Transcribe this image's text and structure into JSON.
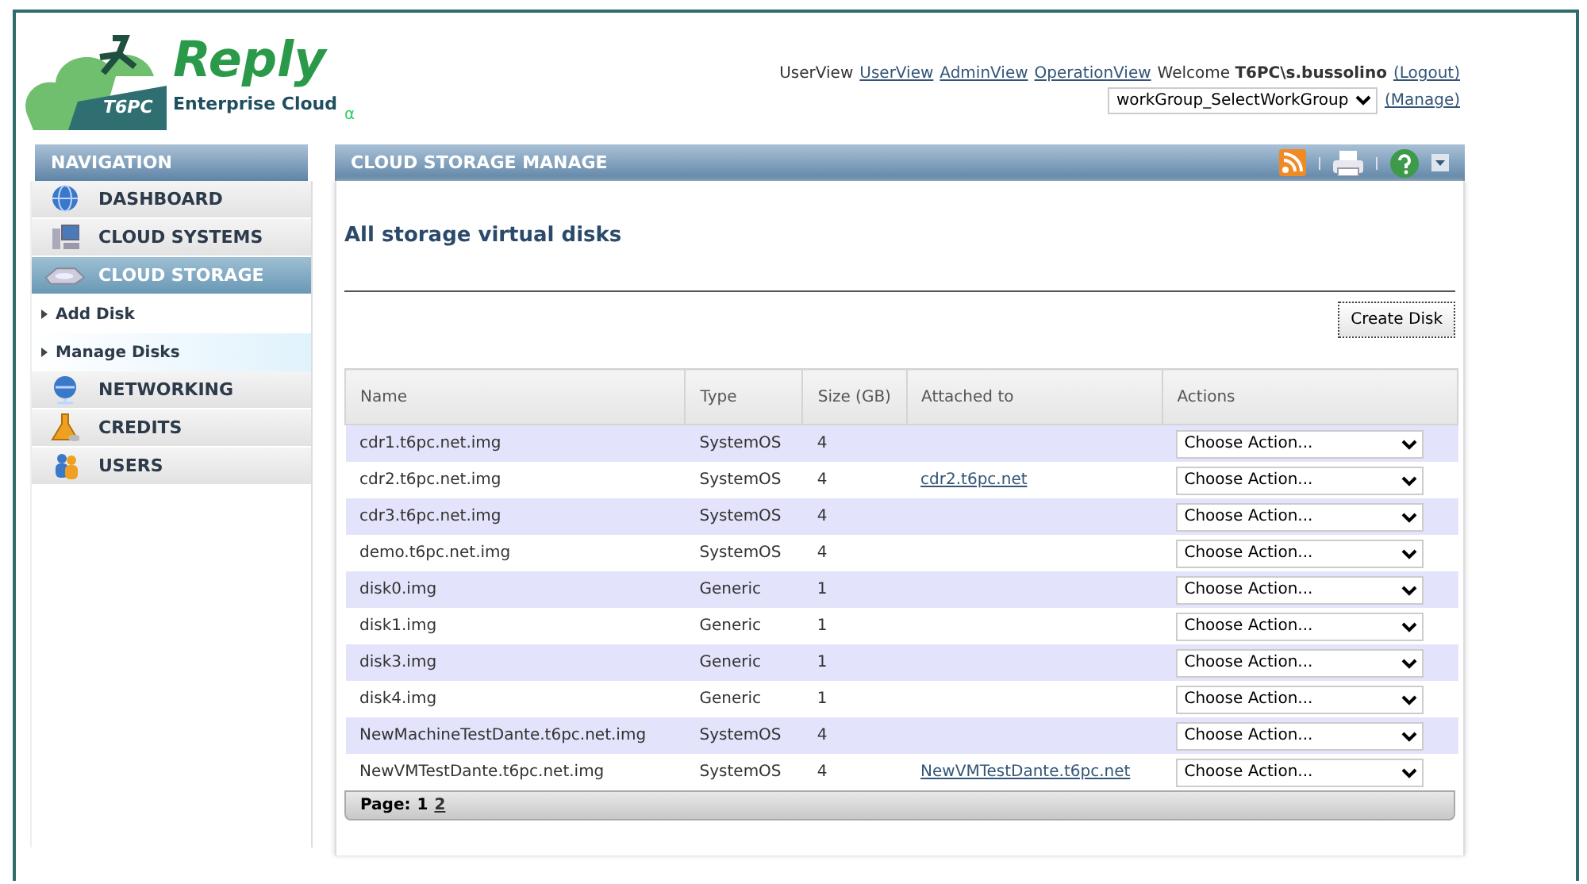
{
  "logo": {
    "brand": "Reply",
    "badge": "T6PC",
    "product": "Enterprise Cloud",
    "version": "α"
  },
  "user_bar": {
    "label": "UserView",
    "links": [
      "UserView",
      "AdminView",
      "OperationView"
    ],
    "welcome": "Welcome **T6PC\\s.bussolino**",
    "logout": "(Logout)",
    "workgroup": "workGroup_SelectWorkGroup",
    "manage": "(Manage)"
  },
  "navigation": {
    "title": "NAVIGATION",
    "items": [
      {
        "kind": "main",
        "label": "DASHBOARD",
        "selected": false
      },
      {
        "kind": "main",
        "label": "CLOUD SYSTEMS",
        "selected": false
      },
      {
        "kind": "main",
        "label": "CLOUD STORAGE",
        "selected": true
      },
      {
        "kind": "sub",
        "label": "Add Disk",
        "selected": false
      },
      {
        "kind": "sub",
        "label": "Manage Disks",
        "selected": true
      },
      {
        "kind": "main",
        "label": "NETWORKING",
        "selected": false
      },
      {
        "kind": "main",
        "label": "CREDITS",
        "selected": false
      },
      {
        "kind": "main",
        "label": "USERS",
        "selected": false
      }
    ]
  },
  "panel": {
    "title": "CLOUD STORAGE MANAGE",
    "heading": "All storage virtual disks",
    "create_button": "Create Disk",
    "table": {
      "columns": [
        "Name",
        "Type",
        "Size (GB)",
        "Attached to",
        "Actions"
      ],
      "rows": [
        {
          "name": "cdr1.t6pc.net.img",
          "type": "SystemOS",
          "size": "4",
          "attached": "",
          "action": "Choose Action..."
        },
        {
          "name": "cdr2.t6pc.net.img",
          "type": "SystemOS",
          "size": "4",
          "attached": "cdr2.t6pc.net",
          "action": "Choose Action..."
        },
        {
          "name": "cdr3.t6pc.net.img",
          "type": "SystemOS",
          "size": "4",
          "attached": "",
          "action": "Choose Action..."
        },
        {
          "name": "demo.t6pc.net.img",
          "type": "SystemOS",
          "size": "4",
          "attached": "",
          "action": "Choose Action..."
        },
        {
          "name": "disk0.img",
          "type": "Generic",
          "size": "1",
          "attached": "",
          "action": "Choose Action..."
        },
        {
          "name": "disk1.img",
          "type": "Generic",
          "size": "1",
          "attached": "",
          "action": "Choose Action..."
        },
        {
          "name": "disk3.img",
          "type": "Generic",
          "size": "1",
          "attached": "",
          "action": "Choose Action..."
        },
        {
          "name": "disk4.img",
          "type": "Generic",
          "size": "1",
          "attached": "",
          "action": "Choose Action..."
        },
        {
          "name": "NewMachineTestDante.t6pc.net.img",
          "type": "SystemOS",
          "size": "4",
          "attached": "",
          "action": "Choose Action..."
        },
        {
          "name": "NewVMTestDante.t6pc.net.img",
          "type": "SystemOS",
          "size": "4",
          "attached": "NewVMTestDante.t6pc.net",
          "action": "Choose Action..."
        }
      ]
    },
    "pager": {
      "label": "Page:",
      "pages": [
        {
          "label": "1",
          "selected": true
        },
        {
          "label": "2",
          "selected": false
        }
      ]
    }
  }
}
